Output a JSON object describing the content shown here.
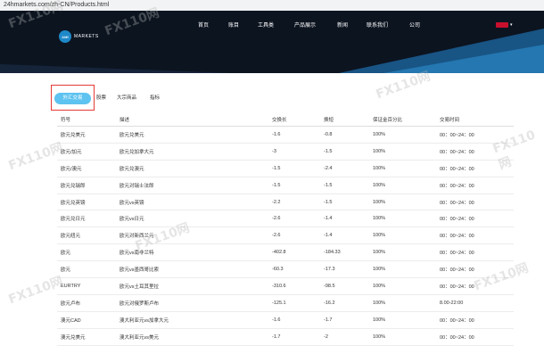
{
  "browser": {
    "url": "24hmarkets.com/zh-CN/Products.html"
  },
  "header": {
    "logo_mark": "24H",
    "logo_text": "MARKETS",
    "nav": [
      "首页",
      "账目",
      "工具类",
      "产品展示",
      "新闻",
      "联系我们",
      "公司"
    ],
    "colors": {
      "background": "#0c1420",
      "accent": "#1e88c8"
    }
  },
  "tabs": {
    "items": [
      "外汇交易",
      "股票",
      "大宗商品",
      "指标"
    ],
    "active_index": 0,
    "active_color": "#5ec3f0"
  },
  "table": {
    "columns": [
      "符号",
      "描述",
      "交换长",
      "换短",
      "保证金百分比",
      "交易时间"
    ],
    "rows": [
      [
        "欧元兑美元",
        "欧元兑美元",
        "-1.6",
        "-0.8",
        "100%",
        "00：00~24：00"
      ],
      [
        "欧元/加元",
        "欧元兑加拿大元",
        "-3",
        "-1.5",
        "100%",
        "00：00~24：00"
      ],
      [
        "欧元/澳元",
        "欧元兑澳元",
        "-1.5",
        "-2.4",
        "100%",
        "00：00~24：00"
      ],
      [
        "欧元兑瑞郎",
        "欧元对瑞士法郎",
        "-1.5",
        "-1.5",
        "100%",
        "00：00~24：00"
      ],
      [
        "欧元兑英镑",
        "欧元vs英镑",
        "-2.2",
        "-1.5",
        "100%",
        "00：00~24：00"
      ],
      [
        "欧元兑日元",
        "欧元vs日元",
        "-2.6",
        "-1.4",
        "100%",
        "00：00~24：00"
      ],
      [
        "欧元纽元",
        "欧元对新西兰元",
        "-2.6",
        "-1.4",
        "100%",
        "00：00~24：00"
      ],
      [
        "欧元",
        "欧元vs南非兰特",
        "-402.8",
        "-184.33",
        "100%",
        "00：00~24：00"
      ],
      [
        "欧元",
        "欧元vs墨西哥比索",
        "-60.3",
        "-17.3",
        "100%",
        "00：00~24：00"
      ],
      [
        "EURTRY",
        "欧元vs土耳其里拉",
        "-310.6",
        "-98.5",
        "100%",
        "00：00~24：00"
      ],
      [
        "欧元卢布",
        "欧元对俄罗斯卢布",
        "-125.1",
        "-16.2",
        "100%",
        "8.00-22:00"
      ],
      [
        "澳元CAD",
        "澳大利亚元vs加拿大元",
        "-1.6",
        "-1.7",
        "100%",
        "00：00~24：00"
      ],
      [
        "澳元兑美元",
        "澳大利亚元vs美元",
        "-1.7",
        "-2",
        "100%",
        "00：00~24：00"
      ]
    ]
  },
  "watermark": "FX110网"
}
